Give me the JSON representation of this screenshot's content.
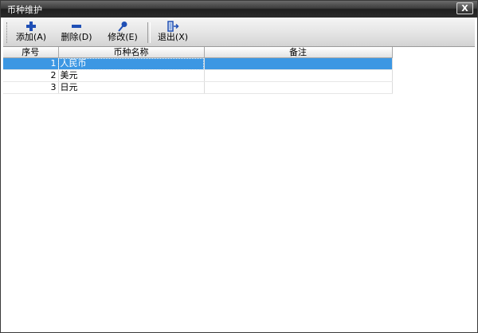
{
  "window": {
    "title": "币种维护",
    "close_label": "X"
  },
  "toolbar": {
    "buttons": [
      {
        "label": "添加(A)",
        "icon": "plus-icon",
        "color": "#1f4fb5"
      },
      {
        "label": "删除(D)",
        "icon": "minus-icon",
        "color": "#1f4fb5"
      },
      {
        "label": "修改(E)",
        "icon": "edit-icon",
        "color": "#1f4fb5"
      },
      {
        "label": "退出(X)",
        "icon": "exit-door-icon",
        "color": "#1f4fb5"
      }
    ]
  },
  "grid": {
    "columns": [
      "序号",
      "币种名称",
      "备注"
    ],
    "rows": [
      {
        "seq": "1",
        "name": "人民币",
        "note": ""
      },
      {
        "seq": "2",
        "name": "美元",
        "note": ""
      },
      {
        "seq": "3",
        "name": "日元",
        "note": ""
      }
    ],
    "selected_row": 1,
    "selection_color": "#3c97e3"
  }
}
